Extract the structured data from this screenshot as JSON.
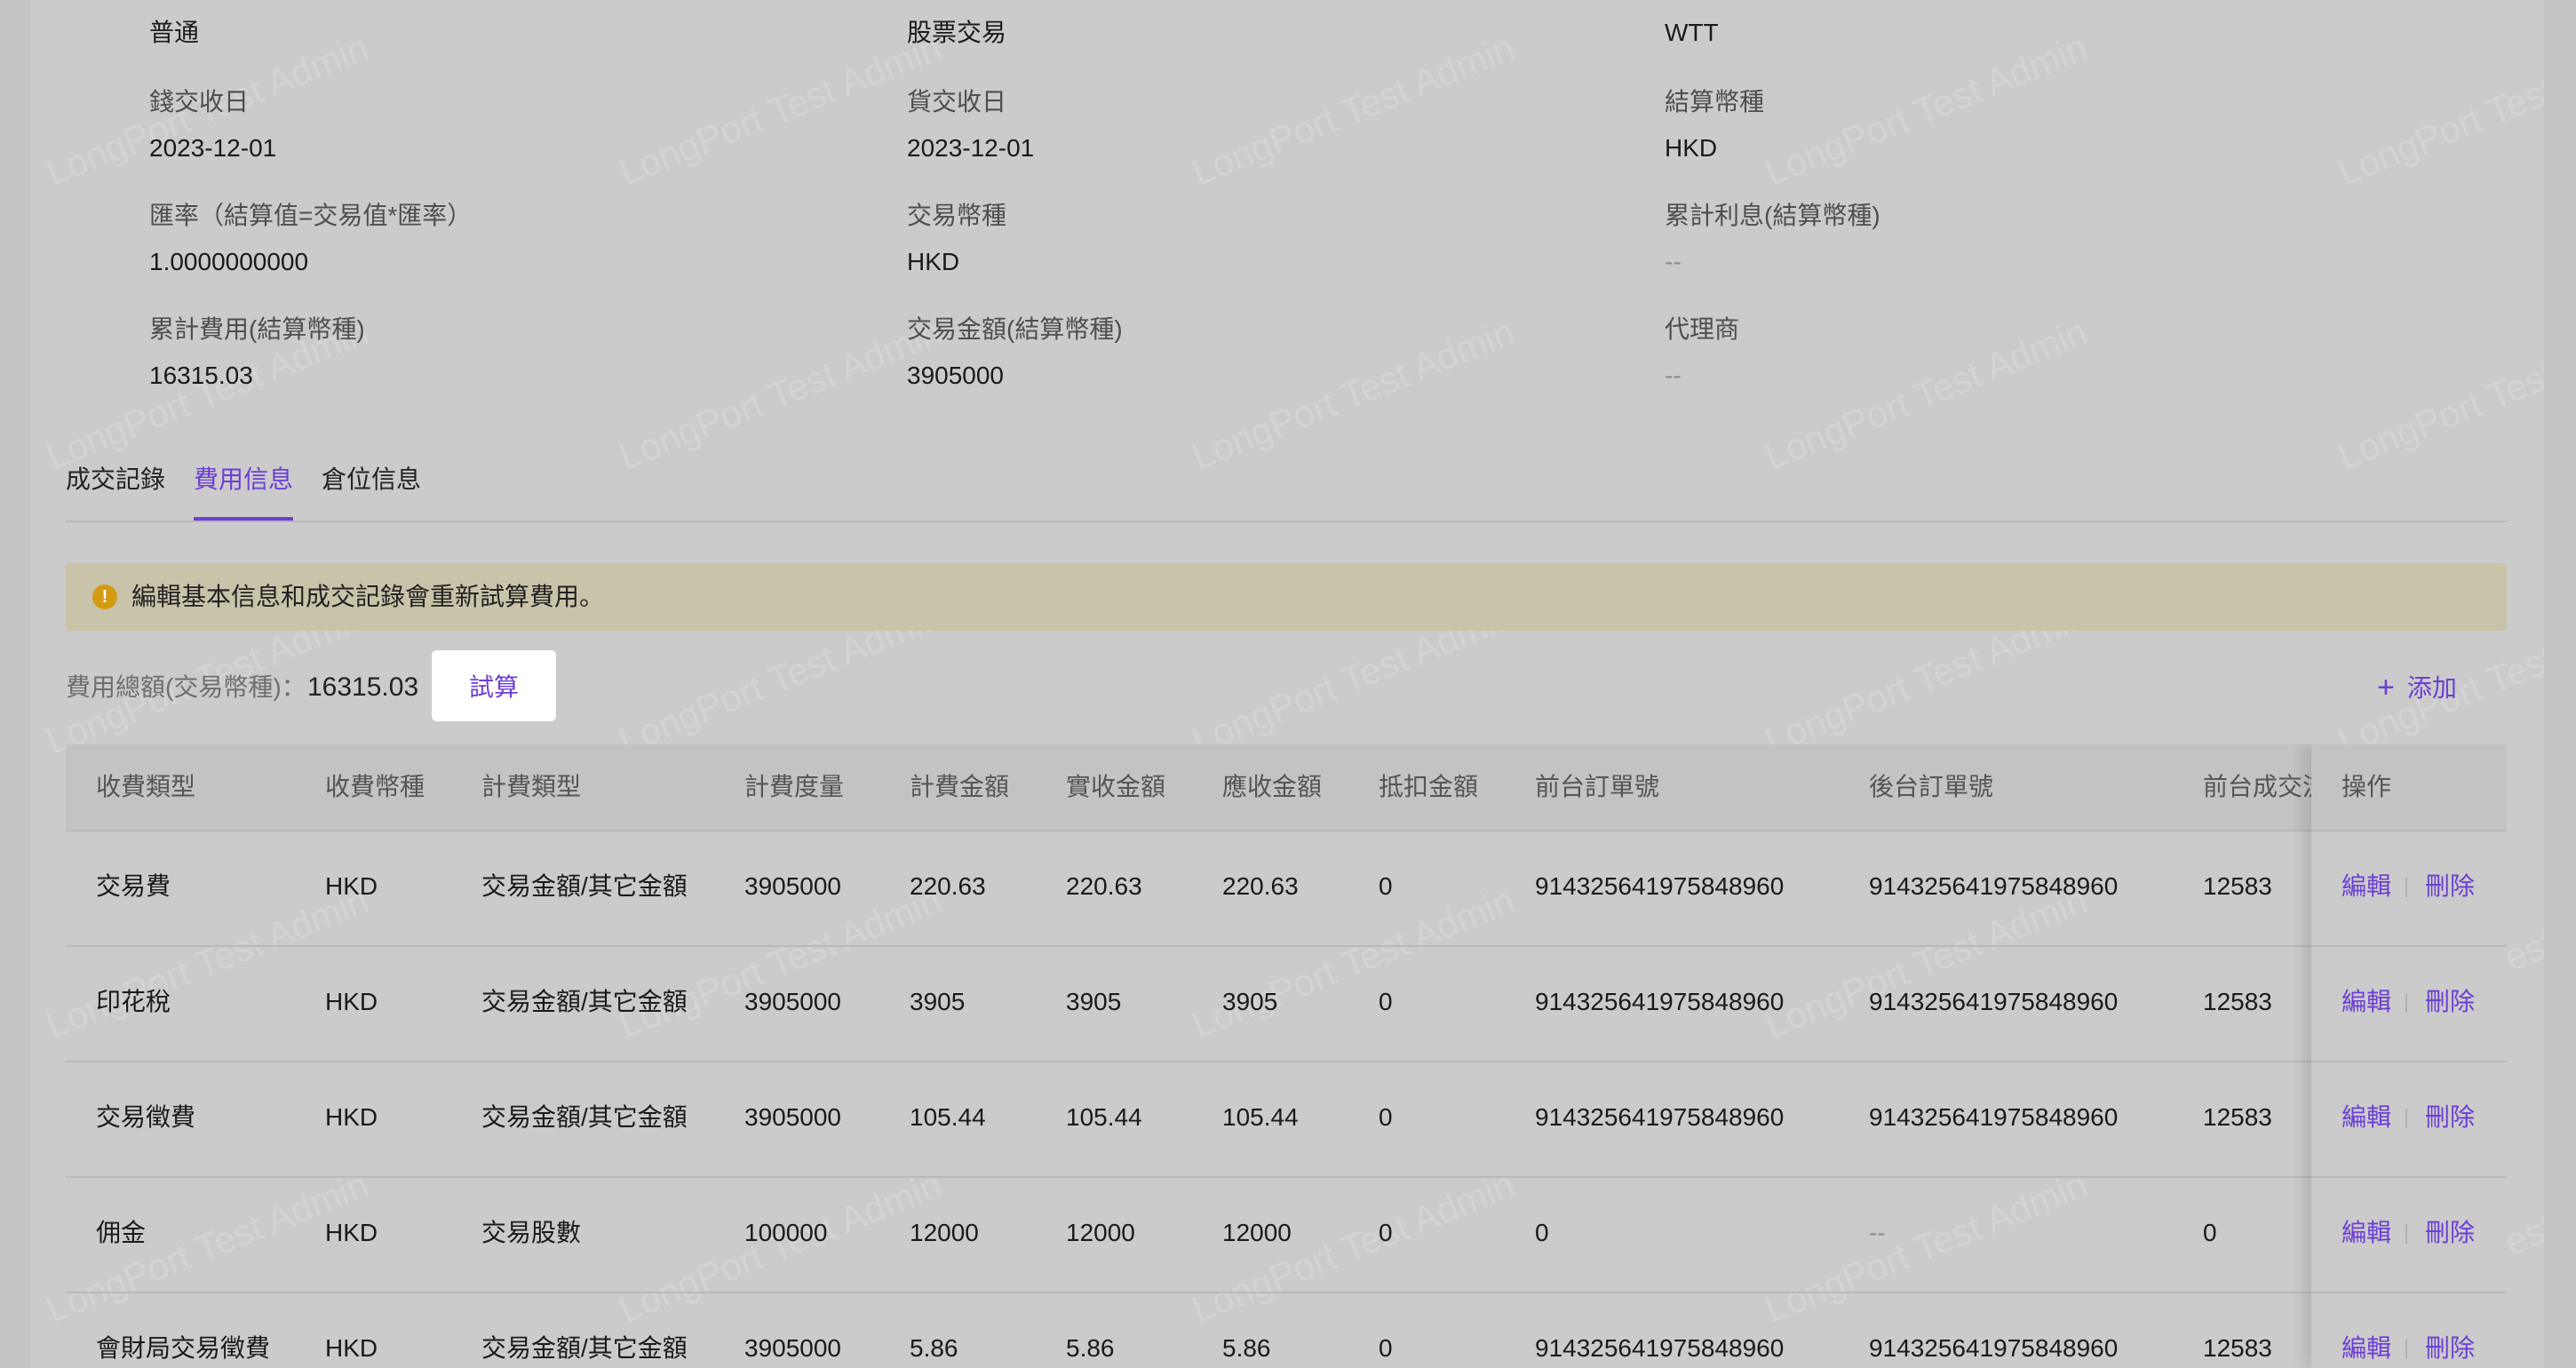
{
  "info": {
    "row0": {
      "col1": "普通",
      "col2": "股票交易",
      "col3": "WTT"
    },
    "row1": {
      "col1": {
        "label": "錢交收日",
        "value": "2023-12-01"
      },
      "col2": {
        "label": "貨交收日",
        "value": "2023-12-01"
      },
      "col3": {
        "label": "結算幣種",
        "value": "HKD"
      }
    },
    "row2": {
      "col1": {
        "label": "匯率（結算值=交易值*匯率）",
        "value": "1.0000000000"
      },
      "col2": {
        "label": "交易幣種",
        "value": "HKD"
      },
      "col3": {
        "label": "累計利息(結算幣種)",
        "value": "--"
      }
    },
    "row3": {
      "col1": {
        "label": "累計費用(結算幣種)",
        "value": "16315.03"
      },
      "col2": {
        "label": "交易金額(結算幣種)",
        "value": "3905000"
      },
      "col3": {
        "label": "代理商",
        "value": "--"
      }
    }
  },
  "tabs": [
    "成交記錄",
    "費用信息",
    "倉位信息"
  ],
  "active_tab": "費用信息",
  "alert": {
    "text": "編輯基本信息和成交記錄會重新試算費用。",
    "icon": "exclamation-circle-icon",
    "color": "#d39a12"
  },
  "summary": {
    "label": "費用總額(交易幣種)：",
    "value": "16315.03",
    "calc_button": "試算"
  },
  "add_button": "添加",
  "accent_color": "#6b3fd4",
  "table": {
    "columns": [
      "收費類型",
      "收費幣種",
      "計費類型",
      "計費度量",
      "計費金額",
      "實收金額",
      "應收金額",
      "抵扣金額",
      "前台訂單號",
      "後台訂單號",
      "前台成交流",
      "操作"
    ],
    "rows": [
      [
        "交易費",
        "HKD",
        "交易金額/其它金額",
        "3905000",
        "220.63",
        "220.63",
        "220.63",
        "0",
        "914325641975848960",
        "914325641975848960",
        "12583"
      ],
      [
        "印花稅",
        "HKD",
        "交易金額/其它金額",
        "3905000",
        "3905",
        "3905",
        "3905",
        "0",
        "914325641975848960",
        "914325641975848960",
        "12583"
      ],
      [
        "交易徵費",
        "HKD",
        "交易金額/其它金額",
        "3905000",
        "105.44",
        "105.44",
        "105.44",
        "0",
        "914325641975848960",
        "914325641975848960",
        "12583"
      ],
      [
        "佣金",
        "HKD",
        "交易股數",
        "100000",
        "12000",
        "12000",
        "12000",
        "0",
        "0",
        "--",
        "0"
      ],
      [
        "會財局交易徵費",
        "HKD",
        "交易金額/其它金額",
        "3905000",
        "5.86",
        "5.86",
        "5.86",
        "0",
        "914325641975848960",
        "914325641975848960",
        "12583"
      ]
    ],
    "actions": {
      "edit": "編輯",
      "delete": "刪除"
    }
  },
  "watermark": "LongPort Test Admin"
}
